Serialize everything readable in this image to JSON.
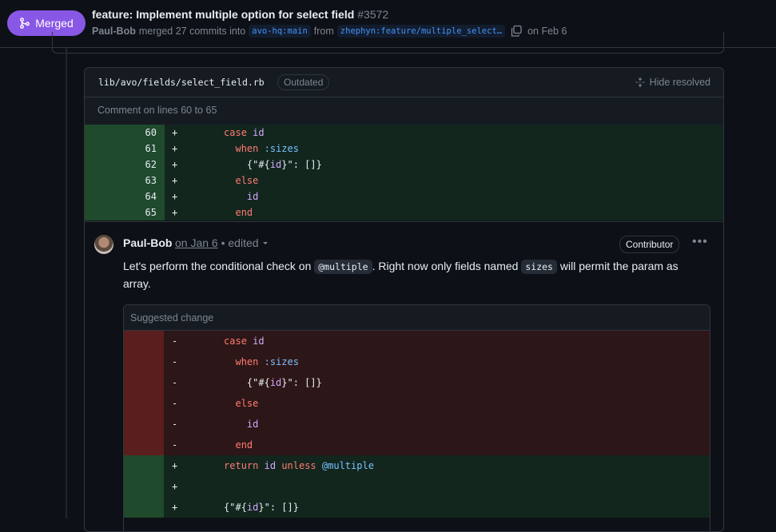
{
  "header": {
    "status": "Merged",
    "title": "feature: Implement multiple option for select field",
    "number": "#3572",
    "author": "Paul-Bob",
    "merged_text": "merged 27 commits into",
    "base_branch": "avo-hq:main",
    "from_text": "from",
    "head_branch": "zhephyn:feature/multiple_select…",
    "date_text": "on Feb 6"
  },
  "file": {
    "path": "lib/avo/fields/select_field.rb",
    "badge": "Outdated",
    "hide_resolved": "Hide resolved",
    "comment_lines": "Comment on lines 60 to 65"
  },
  "diff": {
    "numbers": [
      "60",
      "61",
      "62",
      "63",
      "64",
      "65"
    ]
  },
  "comment": {
    "author": "Paul-Bob",
    "date": "on Jan 6",
    "edited": "• edited",
    "role": "Contributor",
    "more": "•••",
    "text_1": "Let's perform the conditional check on",
    "code_1": "@multiple",
    "text_2": ". Right now only fields named",
    "code_2": "sizes",
    "text_3": "will permit the param as array."
  },
  "suggestion": {
    "label": "Suggested change"
  },
  "colors": {
    "merged": "#8957e5",
    "addition_bg": "#12261e",
    "deletion_bg": "#2d1617",
    "keyword": "#ff7b72",
    "identifier": "#d2a8ff",
    "symbol": "#79c0ff"
  }
}
